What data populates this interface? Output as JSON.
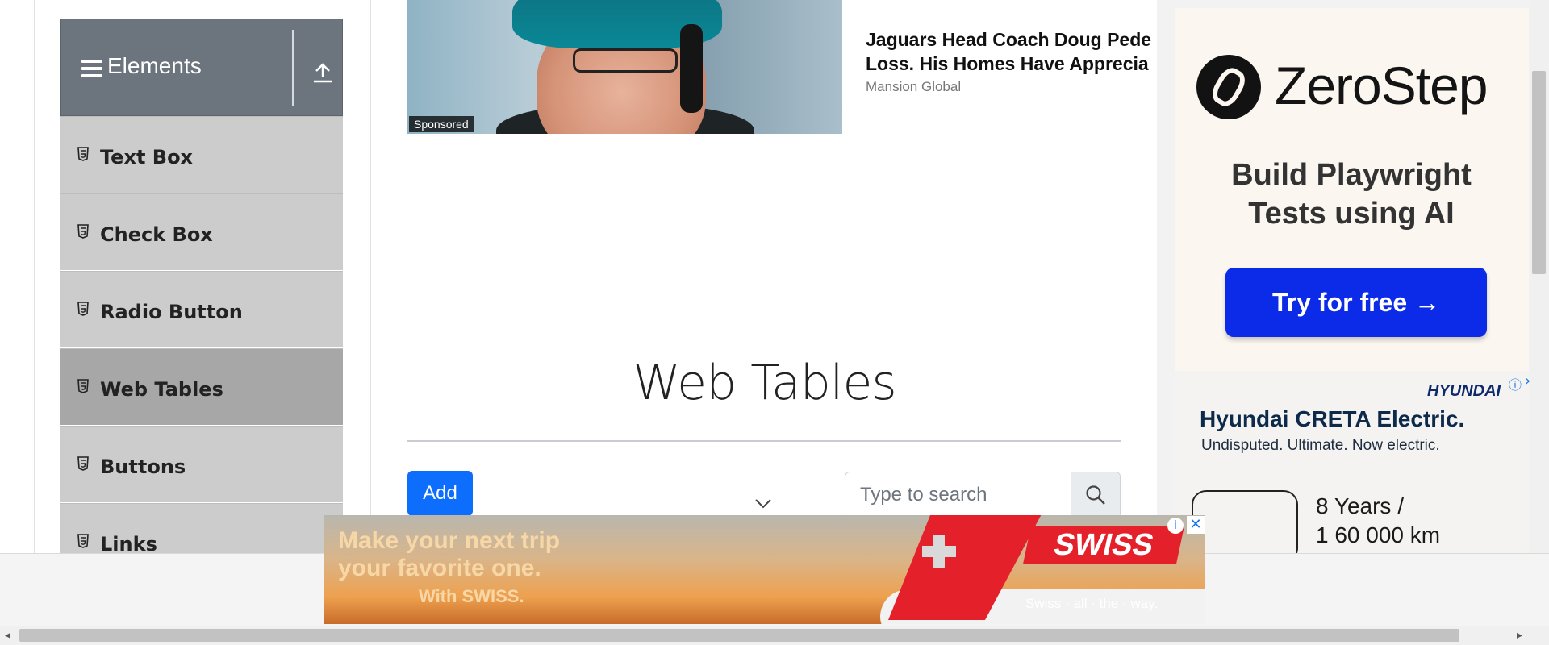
{
  "sidebar": {
    "group_title": "Elements",
    "items": [
      {
        "label": "Text Box"
      },
      {
        "label": "Check Box"
      },
      {
        "label": "Radio Button"
      },
      {
        "label": "Web Tables"
      },
      {
        "label": "Buttons"
      },
      {
        "label": "Links"
      }
    ],
    "active_item": "Web Tables"
  },
  "sponsored": {
    "tag": "Sponsored",
    "headline_line1": "Jaguars Head Coach Doug Pede",
    "headline_line2": "Loss. His Homes Have Apprecia",
    "source": "Mansion Global"
  },
  "main": {
    "title": "Web Tables",
    "add_label": "Add",
    "search_placeholder": "Type to search"
  },
  "zerostep_ad": {
    "brand": "ZeroStep",
    "tagline_line1": "Build Playwright",
    "tagline_line2": "Tests using AI",
    "cta": "Try for free →"
  },
  "hyundai_ad": {
    "brand": "HYUNDAI",
    "title": "Hyundai CRETA Electric.",
    "subtitle": "Undisputed. Ultimate. Now electric.",
    "stat_line1": "8 Years /",
    "stat_line2": "1 60 000 km"
  },
  "swiss_ad": {
    "headline_line1": "Make your next trip",
    "headline_line2": "your favorite one.",
    "with": "With SWISS.",
    "brand": "SWISS",
    "slogan": "Swiss · all · the · way."
  },
  "colors": {
    "sidebar_header": "#6c757d",
    "menu_item": "#cccccc",
    "menu_item_active": "#a7a7a7",
    "primary": "#0d6efd",
    "zerostep_cta": "#0b2be8",
    "swiss_red": "#e4202a"
  }
}
